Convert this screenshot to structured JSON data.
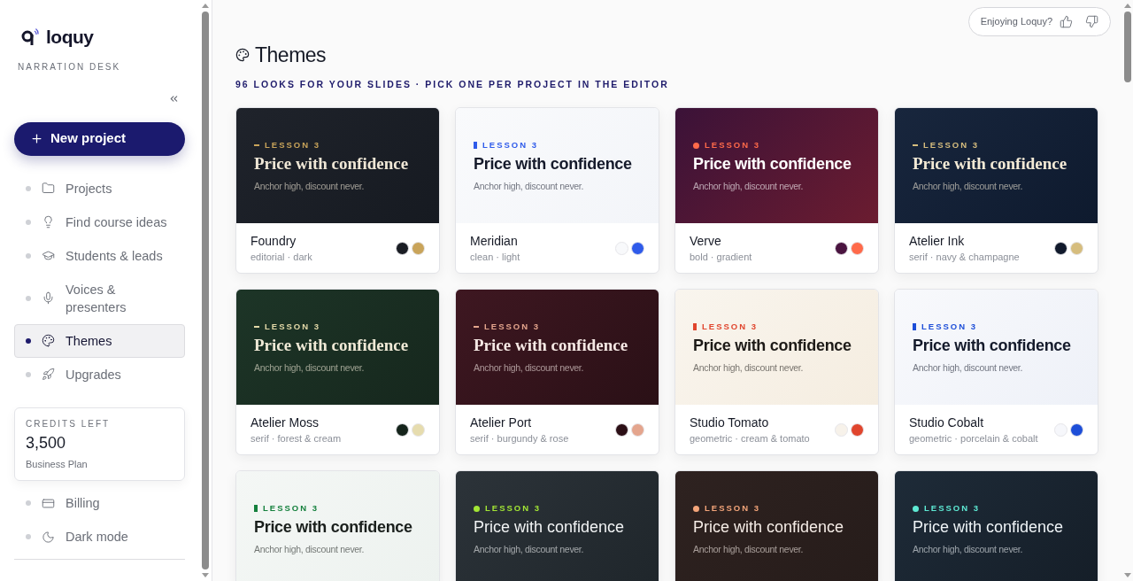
{
  "brand": {
    "name": "loquy",
    "tagline": "NARRATION DESK"
  },
  "new_project": {
    "label": "New project"
  },
  "nav": [
    {
      "label": "Projects",
      "selected": false
    },
    {
      "label": "Find course ideas",
      "selected": false
    },
    {
      "label": "Students & leads",
      "selected": false
    },
    {
      "label": "Voices & presenters",
      "selected": false
    },
    {
      "label": "Themes",
      "selected": true
    },
    {
      "label": "Upgrades",
      "selected": false
    }
  ],
  "credits": {
    "label": "CREDITS LEFT",
    "value": "3,500",
    "plan": "Business Plan"
  },
  "settings": [
    {
      "label": "Billing",
      "selected": false
    },
    {
      "label": "Dark mode",
      "selected": false
    }
  ],
  "feedback": {
    "label": "Enjoying Loquy?"
  },
  "page": {
    "title": "Themes",
    "subtitle": "96 LOOKS FOR YOUR SLIDES · PICK ONE PER PROJECT IN THE EDITOR"
  },
  "themes": [
    {
      "kind": "charcoal",
      "color": "#c9a45a",
      "eyebrow": "LESSON 3",
      "headline": "Price with confidence",
      "tagline": "Anchor high, discount never.",
      "name": "Foundry",
      "tags": "editorial · dark",
      "swatches": [
        {
          "color": "#1a1d24"
        },
        {
          "color": "#c9a45a"
        }
      ]
    },
    {
      "kind": "paper",
      "color": "#2f5bea",
      "eyebrow": "LESSON 3",
      "headline": "Price with confidence",
      "tagline": "Anchor high, discount never.",
      "name": "Meridian",
      "tags": "clean · light",
      "swatches": [
        {
          "color": "#f8f9fb"
        },
        {
          "color": "#2f5bea"
        }
      ]
    },
    {
      "kind": "plum",
      "color": "#ff6a4a",
      "eyebrow": "LESSON 3",
      "headline": "Price with confidence",
      "tagline": "Anchor high, discount never.",
      "name": "Verve",
      "tags": "bold · gradient",
      "swatches": [
        {
          "color": "#4a1440"
        },
        {
          "color": "#ff6a4a"
        }
      ]
    },
    {
      "kind": "navy",
      "color": "#d6bd7e",
      "eyebrow": "LESSON 3",
      "headline": "Price with confidence",
      "tagline": "Anchor high, discount never.",
      "name": "Atelier Ink",
      "tags": "serif · navy & champagne",
      "swatches": [
        {
          "color": "#111a2c"
        },
        {
          "color": "#d6bd7e"
        }
      ]
    },
    {
      "kind": "forest",
      "color": "#e3d9a8",
      "eyebrow": "LESSON 3",
      "headline": "Price with confidence",
      "tagline": "Anchor high, discount never.",
      "name": "Atelier Moss",
      "tags": "serif · forest & cream",
      "swatches": [
        {
          "color": "#15241b"
        },
        {
          "color": "#e6dcae"
        }
      ]
    },
    {
      "kind": "wine",
      "color": "#e4a58d",
      "eyebrow": "LESSON 3",
      "headline": "Price with confidence",
      "tagline": "Anchor high, discount never.",
      "name": "Atelier Port",
      "tags": "serif · burgundy & rose",
      "swatches": [
        {
          "color": "#2c0f16"
        },
        {
          "color": "#e4a58d"
        }
      ]
    },
    {
      "kind": "cream",
      "color": "#e0452d",
      "eyebrow": "LESSON 3",
      "headline": "Price with confidence",
      "tagline": "Anchor high, discount never.",
      "name": "Studio Tomato",
      "tags": "geometric · cream & tomato",
      "swatches": [
        {
          "color": "#f7f2ea"
        },
        {
          "color": "#e0452d"
        }
      ]
    },
    {
      "kind": "porcelain",
      "color": "#1d4ed8",
      "eyebrow": "LESSON 3",
      "headline": "Price with confidence",
      "tagline": "Anchor high, discount never.",
      "name": "Studio Cobalt",
      "tags": "geometric · porcelain & cobalt",
      "swatches": [
        {
          "color": "#f6f7fb"
        },
        {
          "color": "#1d4ed8"
        }
      ]
    },
    {
      "kind": "mint",
      "color": "#15803d",
      "eyebrow": "LESSON 3",
      "headline": "Price with confidence",
      "tagline": "Anchor high, discount never."
    },
    {
      "kind": "slate",
      "color": "#a3e635",
      "eyebrow": "LESSON 3",
      "headline": "Price with confidence",
      "tagline": "Anchor high, discount never."
    },
    {
      "kind": "cocoa",
      "color": "#f4a57a",
      "eyebrow": "LESSON 3",
      "headline": "Price with confidence",
      "tagline": "Anchor high, discount never."
    },
    {
      "kind": "midnight",
      "color": "#5eead4",
      "eyebrow": "LESSON 3",
      "headline": "Price with confidence",
      "tagline": "Anchor high, discount never."
    }
  ]
}
